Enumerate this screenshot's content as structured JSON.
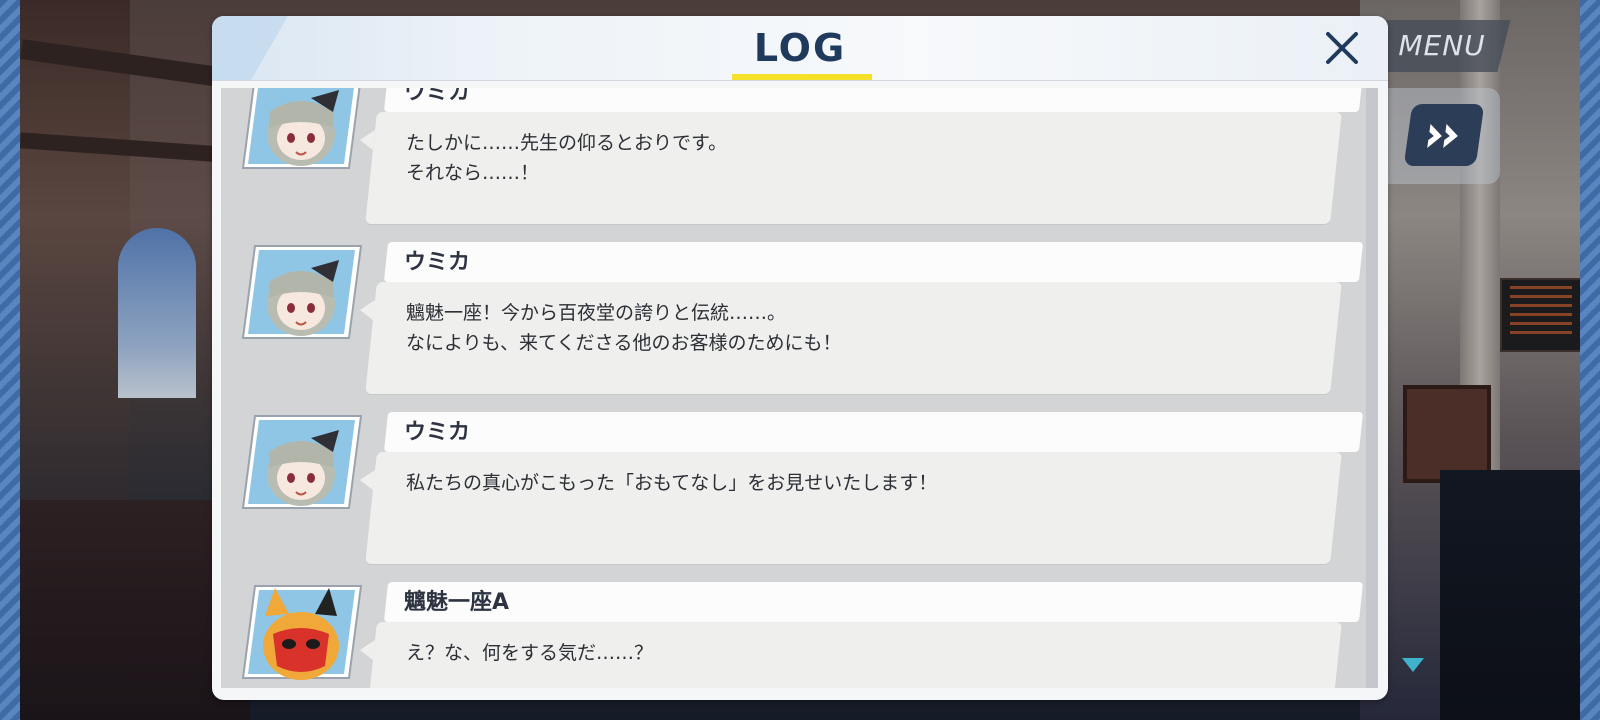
{
  "header": {
    "title": "LOG"
  },
  "top_right": {
    "menu_label": "MENU"
  },
  "entries": [
    {
      "speaker": "ウミカ",
      "lines": [
        "たしかに……先生の仰るとおりです。",
        "それなら……！"
      ]
    },
    {
      "speaker": "ウミカ",
      "lines": [
        "魑魅一座！今から百夜堂の誇りと伝統……。",
        "なによりも、来てくださる他のお客様のためにも！"
      ]
    },
    {
      "speaker": "ウミカ",
      "lines": [
        "私たちの真心がこもった「おもてなし」をお見せいたします！",
        ""
      ]
    },
    {
      "speaker": "魑魅一座A",
      "lines": [
        "え？な、何をする気だ……？",
        ""
      ]
    }
  ],
  "colors": {
    "title": "#1f3a5c",
    "underline": "#f5e12a",
    "accent": "#3fb2cc"
  },
  "icons": {
    "close": "close-icon",
    "fast_forward": "fast-forward-icon",
    "scroll": "chevron-down-icon"
  }
}
